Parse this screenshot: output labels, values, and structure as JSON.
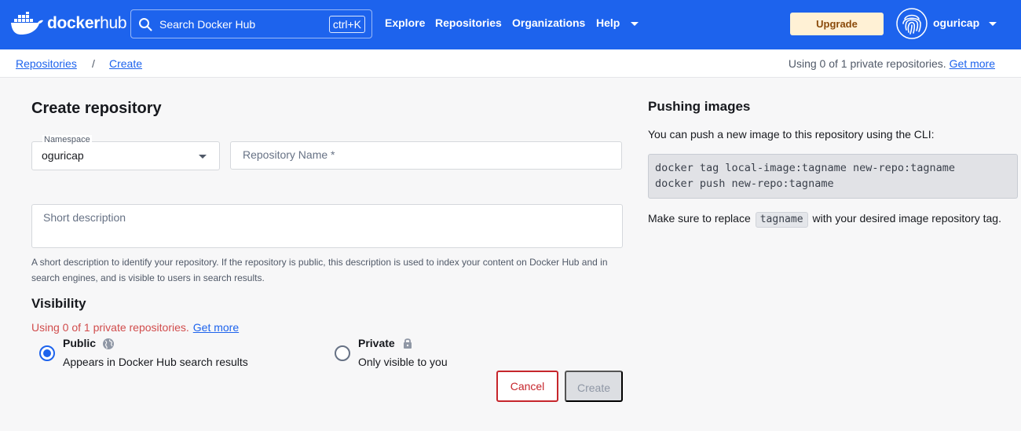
{
  "header": {
    "logo_bold": "docker",
    "logo_light": "hub",
    "search": {
      "placeholder": "Search Docker Hub",
      "shortcut": "ctrl+K"
    },
    "nav": [
      "Explore",
      "Repositories",
      "Organizations",
      "Help"
    ],
    "upgrade_label": "Upgrade",
    "username": "oguricap",
    "brand_color": "#1d63ed"
  },
  "breadcrumb": {
    "items": [
      "Repositories",
      "Create"
    ],
    "separator": "/",
    "usage_text": "Using 0 of 1 private repositories.",
    "usage_link": "Get more"
  },
  "form": {
    "title": "Create repository",
    "namespace": {
      "label": "Namespace",
      "value": "oguricap"
    },
    "repo_name": {
      "placeholder": "Repository Name *"
    },
    "short_description": {
      "placeholder": "Short description"
    },
    "helper_text": "A short description to identify your repository. If the repository is public, this description is used to index your content on Docker Hub and in search engines, and is visible to users in search results.",
    "visibility": {
      "title": "Visibility",
      "usage_text": "Using 0 of 1 private repositories.",
      "usage_link": "Get more",
      "options": [
        {
          "title": "Public",
          "desc": "Appears in Docker Hub search results",
          "selected": true
        },
        {
          "title": "Private",
          "desc": "Only visible to you",
          "selected": false
        }
      ]
    },
    "cancel_label": "Cancel",
    "create_label": "Create"
  },
  "side_panel": {
    "title": "Pushing images",
    "intro": "You can push a new image to this repository using the CLI:",
    "code_lines": [
      "docker tag local-image:tagname new-repo:tagname",
      "docker push new-repo:tagname"
    ],
    "note_before": "Make sure to replace",
    "note_code": "tagname",
    "note_after": "with your desired image repository tag."
  }
}
